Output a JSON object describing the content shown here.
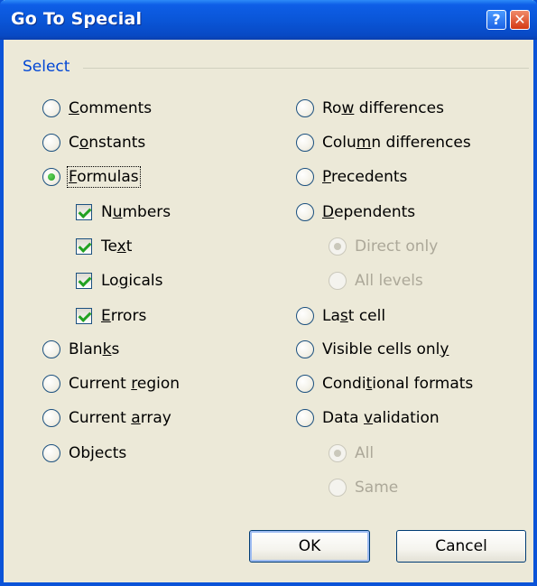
{
  "window": {
    "title": "Go To Special",
    "help_glyph": "?",
    "close_glyph": "✕"
  },
  "group": {
    "label": "Select"
  },
  "options": {
    "comments": {
      "pre": "",
      "u": "C",
      "post": "omments"
    },
    "constants": {
      "pre": "C",
      "u": "o",
      "post": "nstants"
    },
    "formulas": {
      "pre": "",
      "u": "F",
      "post": "ormulas"
    },
    "numbers": {
      "pre": "N",
      "u": "u",
      "post": "mbers"
    },
    "text": {
      "pre": "Te",
      "u": "x",
      "post": "t"
    },
    "logicals": {
      "pre": "Lo",
      "u": "g",
      "post": "icals"
    },
    "errors": {
      "pre": "",
      "u": "E",
      "post": "rrors"
    },
    "blanks": {
      "pre": "Blan",
      "u": "k",
      "post": "s"
    },
    "current_region": {
      "pre": "Current ",
      "u": "r",
      "post": "egion"
    },
    "current_array": {
      "pre": "Current ",
      "u": "a",
      "post": "rray"
    },
    "objects": {
      "pre": "Ob",
      "u": "j",
      "post": "ects"
    },
    "row_differences": {
      "pre": "Ro",
      "u": "w",
      "post": " differences"
    },
    "column_differences": {
      "pre": "Colu",
      "u": "m",
      "post": "n differences"
    },
    "precedents": {
      "pre": "",
      "u": "P",
      "post": "recedents"
    },
    "dependents": {
      "pre": "",
      "u": "D",
      "post": "ependents"
    },
    "direct_only": {
      "pre": "D",
      "u": "i",
      "post": "rect only"
    },
    "all_levels": {
      "pre": "A",
      "u": "l",
      "post": "l levels"
    },
    "last_cell": {
      "pre": "La",
      "u": "s",
      "post": "t cell"
    },
    "visible_cells_only": {
      "pre": "Visible cells onl",
      "u": "y",
      "post": ""
    },
    "conditional_formats": {
      "pre": "Condi",
      "u": "t",
      "post": "ional formats"
    },
    "data_validation": {
      "pre": "Data ",
      "u": "v",
      "post": "alidation"
    },
    "dv_all": {
      "pre": "A",
      "u": "l",
      "post": "l"
    },
    "dv_same": {
      "pre": "Sam",
      "u": "e",
      "post": ""
    }
  },
  "buttons": {
    "ok": "OK",
    "cancel": "Cancel"
  }
}
